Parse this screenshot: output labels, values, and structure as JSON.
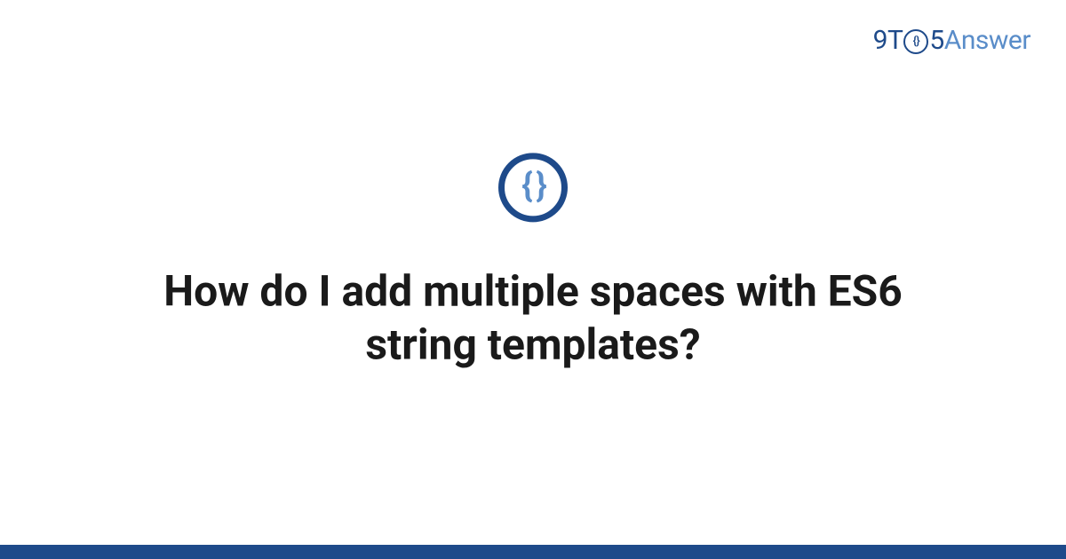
{
  "logo": {
    "part1": "9T",
    "circle_inner": "{}",
    "part2": "5",
    "part3": "Answer"
  },
  "icon": {
    "name": "braces-icon",
    "glyph": "{ }"
  },
  "title": "How do I add multiple spaces with ES6 string templates?",
  "colors": {
    "primary": "#1e4a8a",
    "accent": "#5a8dc9",
    "text": "#1a1a1a",
    "background": "#ffffff"
  }
}
